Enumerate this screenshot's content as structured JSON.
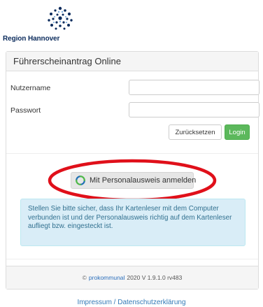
{
  "brand": {
    "logo_text": "Region Hannover"
  },
  "panel": {
    "title": "Führerscheinantrag Online"
  },
  "form": {
    "username_label": "Nutzername",
    "username_value": "",
    "password_label": "Passwort",
    "password_value": "",
    "reset_label": "Zurücksetzen",
    "login_label": "Login"
  },
  "eid": {
    "button_label": "Mit Personalausweis anmelden"
  },
  "info": {
    "text": "Stellen Sie bitte sicher, dass Ihr Kartenleser mit dem Computer verbunden ist und der Personalausweis richtig auf dem Kartenleser aufliegt bzw. eingesteckt ist."
  },
  "footer": {
    "copyright_symbol": "©",
    "brand": "prokommunal",
    "version": "2020 V 1.9.1.0 rv483",
    "links": "Impressum / Datenschutzerklärung"
  },
  "colors": {
    "success": "#5cb85c",
    "info_bg": "#d9edf7",
    "info_text": "#31708f",
    "highlight": "#e0101a",
    "logo_blue": "#0b2b5c"
  }
}
